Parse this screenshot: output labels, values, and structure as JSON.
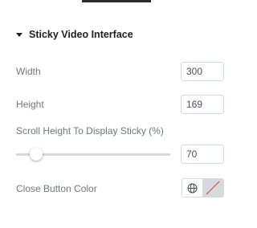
{
  "section": {
    "title": "Sticky Video Interface"
  },
  "fields": {
    "width": {
      "label": "Width",
      "value": "300"
    },
    "height": {
      "label": "Height",
      "value": "169"
    },
    "scroll": {
      "label": "Scroll Height To Display Sticky (%)",
      "value": "70",
      "slider_fraction": 0.13
    },
    "close_color": {
      "label": "Close Button Color"
    }
  },
  "colors": {
    "label": "#6d7882",
    "input_border": "#d5dadf",
    "swatch_bg": "#d5dadf",
    "no_color_slash": "#e04a3a"
  },
  "icons": {
    "collapse": "caret-down-icon",
    "global": "globe-icon",
    "no_color": "no-color-slash-icon"
  }
}
